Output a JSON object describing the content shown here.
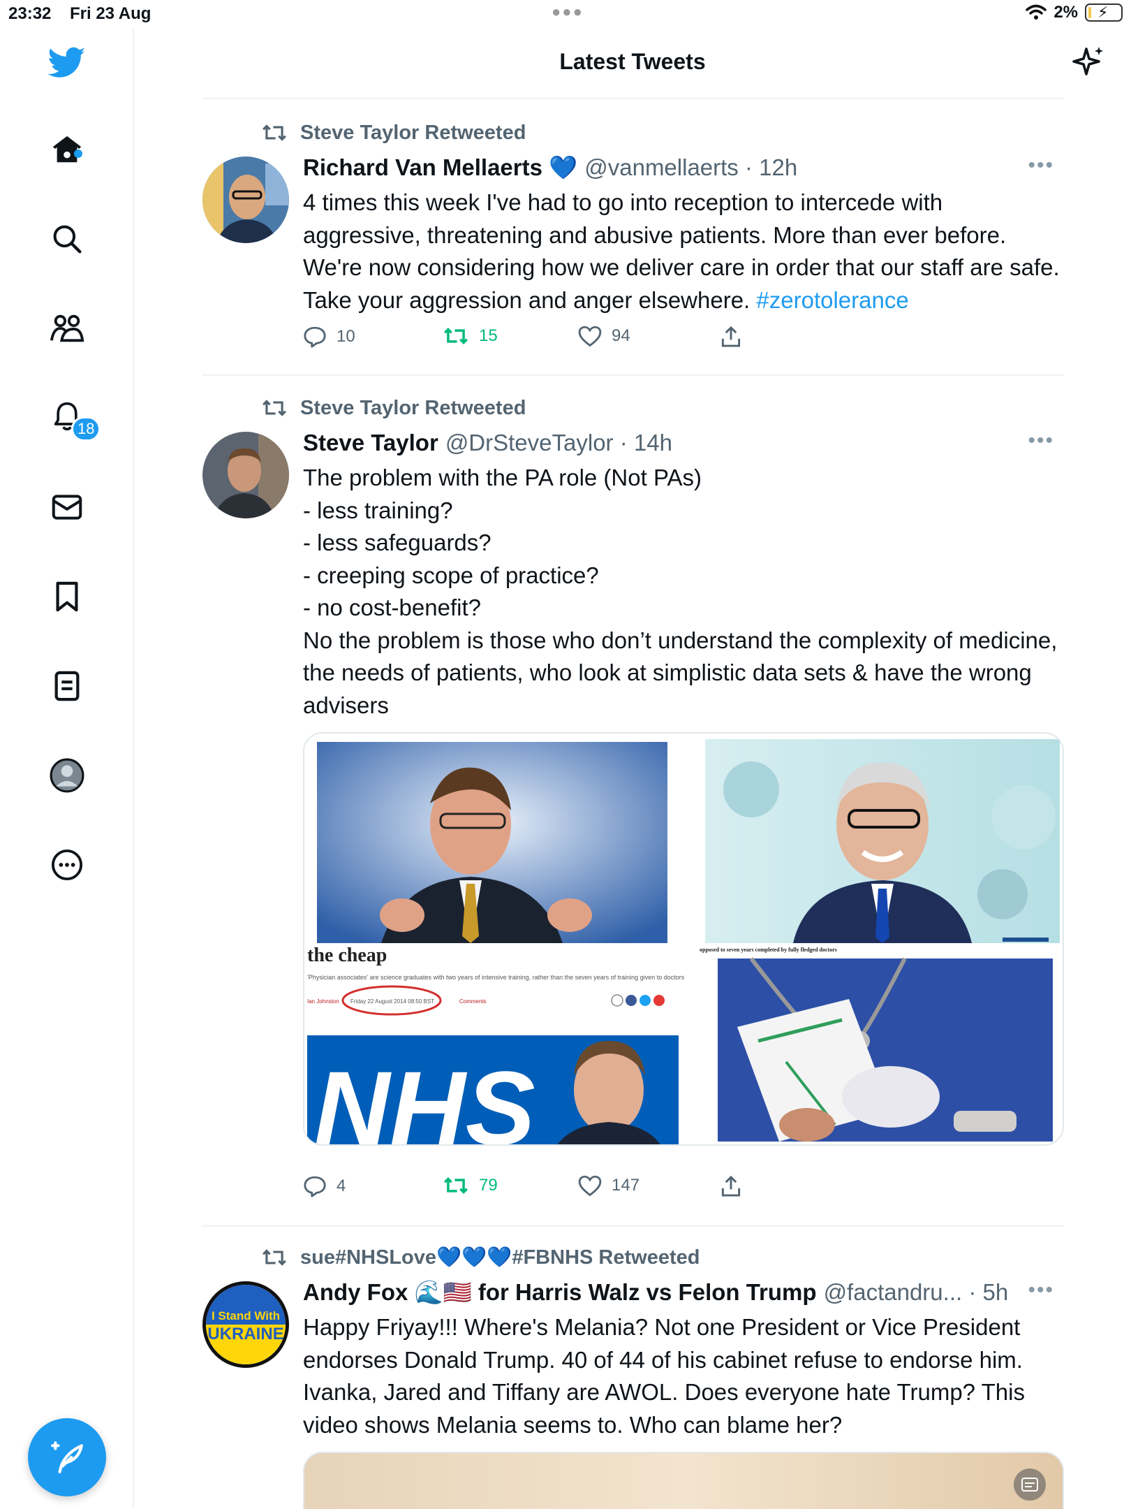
{
  "status_bar": {
    "time": "23:32",
    "date": "Fri 23 Aug",
    "battery": "2%"
  },
  "header": {
    "title": "Latest Tweets"
  },
  "sidebar": {
    "notification_badge": "18"
  },
  "tweets": [
    {
      "retweeted_by": "Steve Taylor Retweeted",
      "name": "Richard Van Mellaerts 💙",
      "handle": "@vanmellaerts · 12h",
      "text": "4 times this week I've had to go into reception to intercede with aggressive, threatening and abusive patients. More than ever before. We're now considering how we deliver care in order that our staff are safe. Take your aggression and anger elsewhere. ",
      "hashtag": "#zerotolerance",
      "replies": "10",
      "retweets": "15",
      "likes": "94"
    },
    {
      "retweeted_by": "Steve Taylor Retweeted",
      "name": "Steve Taylor",
      "handle": "@DrSteveTaylor · 14h",
      "text": "The problem with the PA role (Not PAs)\n- less training?\n- less safeguards?\n- creeping scope of practice?\n- no cost-benefit?\nNo the problem is those who don’t understand the complexity of medicine, the needs of patients, who look at simplistic data sets & have the wrong advisers",
      "media_caption": "'Physician associates' are science graduates with two years of intensive training, rather than the seven years of training given to doctors",
      "media_headline": "the cheap",
      "media_author": "Ian Johnston",
      "media_date": "Friday 22 August 2014 08:50 BST",
      "media_comments": "Comments",
      "media_nhs": "NHS",
      "media_strip": "opposed to seven years completed by fully fledged doctors",
      "replies": "4",
      "retweets": "79",
      "likes": "147"
    },
    {
      "retweeted_by": "sue#NHSLove💙💙💙#FBNHS Retweeted",
      "name": "Andy Fox 🌊🇺🇸 for Harris Walz vs Felon Trump",
      "handle": "@factandru... · 5h",
      "avatar_text_1": "I Stand With",
      "avatar_text_2": "UKRAINE",
      "text": "Happy Friyay!!! Where's Melania? Not one President or Vice President endorses Donald Trump. 40 of 44 of his cabinet refuse to endorse him. Ivanka, Jared and Tiffany are AWOL. Does everyone hate Trump? This video shows Melania seems to. Who can blame her?"
    }
  ],
  "colors": {
    "accent": "#1d9bf0",
    "retweet_green": "#00ba7c",
    "muted": "#536471"
  }
}
